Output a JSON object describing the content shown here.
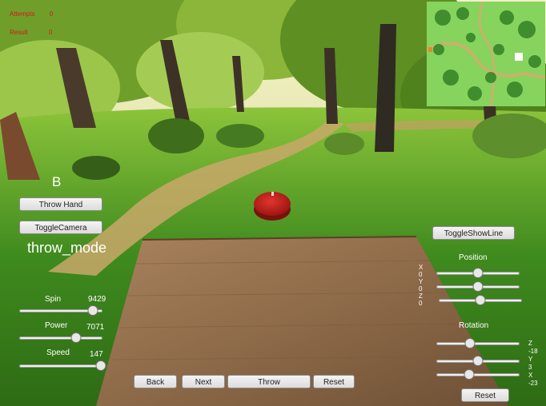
{
  "hud": {
    "top_left_lines": [
      "Attempts",
      "Result"
    ],
    "top_left_values": [
      "0",
      "0"
    ]
  },
  "left_panel": {
    "key_letter": "B",
    "throw_hand_label": "Throw Hand",
    "toggle_camera_label": "ToggleCamera",
    "mode_text": "throw_mode"
  },
  "sliders": {
    "spin": {
      "label": "Spin",
      "value": "9429",
      "level": 0.88
    },
    "power": {
      "label": "Power",
      "value": "7071",
      "level": 0.68
    },
    "speed": {
      "label": "Speed",
      "value": "147",
      "level": 0.98
    }
  },
  "bottom_buttons": {
    "back": "Back",
    "next": "Next",
    "throw": "Throw",
    "reset": "Reset"
  },
  "right_panel": {
    "toggle_showline_label": "ToggleShowLine",
    "position_title": "Position",
    "position_axes": [
      "X",
      "0",
      "Y",
      "0",
      "Z",
      "0"
    ],
    "position_levels": [
      0.5,
      0.5,
      0.5
    ],
    "rotation_title": "Rotation",
    "rotation_axes": [
      "Z",
      "-18",
      "Y",
      "3",
      "X",
      "-23"
    ],
    "rotation_levels": [
      0.4,
      0.5,
      0.39
    ],
    "reset_label": "Reset"
  },
  "colors": {
    "disc": "#c8201c",
    "button_bg": "#e6e6e6",
    "hud_red": "#d21a1a"
  }
}
